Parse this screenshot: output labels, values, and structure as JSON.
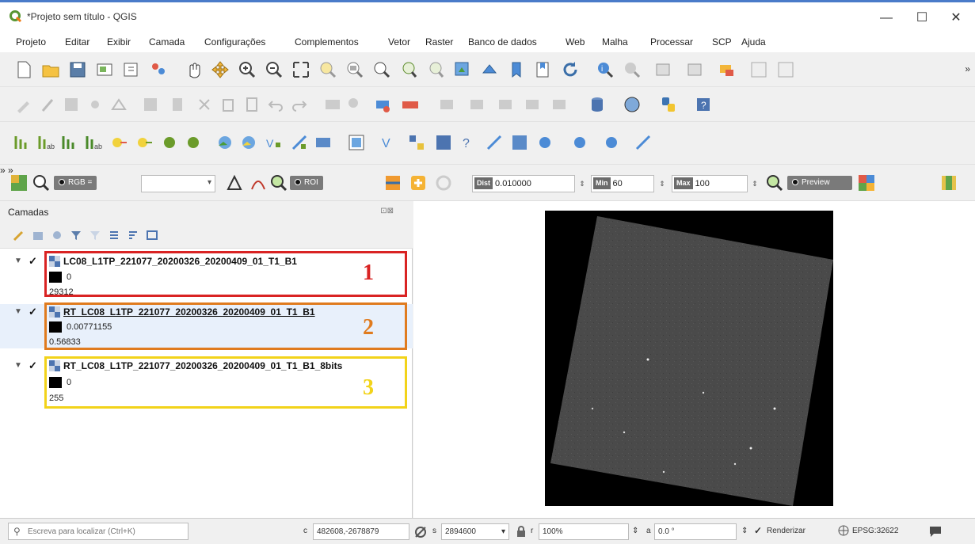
{
  "window": {
    "title": "*Projeto sem título - QGIS",
    "minimize": "—",
    "maximize": "☐",
    "close": "✕"
  },
  "menu": [
    "Projeto",
    "Editar",
    "Exibir",
    "Camada",
    "Configurações",
    "Complementos",
    "Vetor",
    "Raster",
    "Banco de dados",
    "Web",
    "Malha",
    "Processar",
    "SCP",
    "Ajuda"
  ],
  "toolbar": {
    "overflow": "»"
  },
  "scp_toolbar": {
    "rgb_label": "RGB =",
    "roi_label": "ROI",
    "dist_label": "Dist",
    "dist_value": "0.010000",
    "min_label": "Min",
    "min_value": "60",
    "max_label": "Max",
    "max_value": "100",
    "preview_label": "Preview"
  },
  "layers_panel": {
    "title": "Camadas",
    "dock_buttons": "⊡⊠",
    "layers": [
      {
        "name": "LC08_L1TP_221077_20200326_20200409_01_T1_B1",
        "min": "0",
        "max": "29312",
        "badge": "1",
        "badge_color": "#d92323"
      },
      {
        "name": "RT_LC08_L1TP_221077_20200326_20200409_01_T1_B1",
        "min": "0.00771155",
        "max": "0.56833",
        "badge": "2",
        "badge_color": "#e07b1e"
      },
      {
        "name": "RT_LC08_L1TP_221077_20200326_20200409_01_T1_B1_8bits",
        "min": "0",
        "max": "255",
        "badge": "3",
        "badge_color": "#f2d31a"
      }
    ]
  },
  "statusbar": {
    "search_placeholder": "Escreva para localizar (Ctrl+K)",
    "coord_prefix": "c",
    "coordinate": "482608,-2678879",
    "scale_prefix": "s",
    "scale": "2894600",
    "mag_prefix": "r",
    "magnifier": "100%",
    "rot_prefix": "a",
    "rotation": "0.0 °",
    "render_label": "Renderizar",
    "crs": "EPSG:32622"
  },
  "colors": {
    "highlight_1": "#d92323",
    "highlight_2": "#e07b1e",
    "highlight_3": "#f2d31a",
    "raster_fill": "#4a4a4a"
  }
}
